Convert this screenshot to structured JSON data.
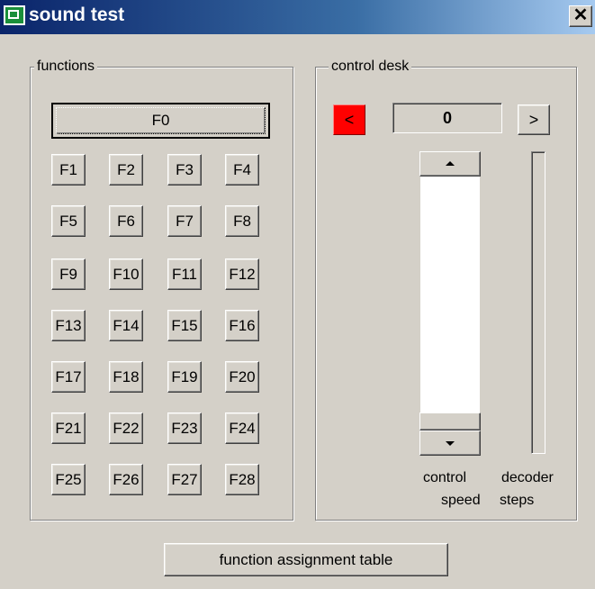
{
  "window": {
    "title": "sound test",
    "close_glyph": "✕"
  },
  "functions": {
    "legend": "functions",
    "f0_label": "F0",
    "buttons": [
      "F1",
      "F2",
      "F3",
      "F4",
      "F5",
      "F6",
      "F7",
      "F8",
      "F9",
      "F10",
      "F11",
      "F12",
      "F13",
      "F14",
      "F15",
      "F16",
      "F17",
      "F18",
      "F19",
      "F20",
      "F21",
      "F22",
      "F23",
      "F24",
      "F25",
      "F26",
      "F27",
      "F28"
    ]
  },
  "control_desk": {
    "legend": "control desk",
    "reverse_glyph": "<",
    "forward_glyph": ">",
    "speed_value": "0",
    "reverse_color": "#ff0000",
    "control_label": "control",
    "speed_label": "speed",
    "decoder_label": "decoder",
    "steps_label": "steps"
  },
  "footer": {
    "assignment_button": "function assignment table"
  },
  "icons": [
    "app-icon",
    "close-icon",
    "scroll-up-icon",
    "scroll-down-icon"
  ]
}
